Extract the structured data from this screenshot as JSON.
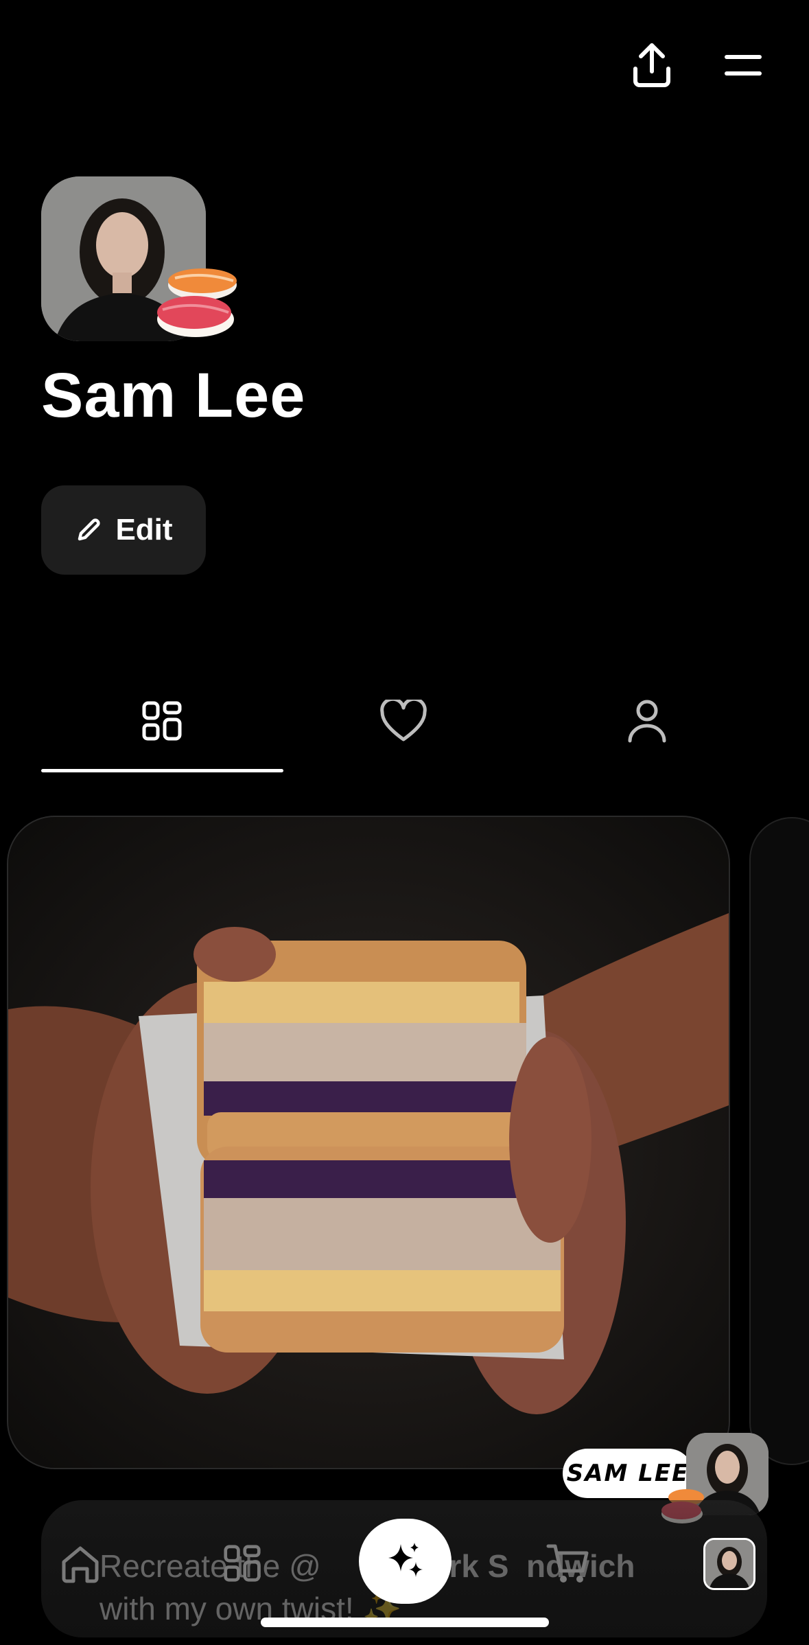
{
  "profile": {
    "name": "Sam Lee",
    "edit_label": "Edit"
  },
  "tabs": [
    {
      "icon": "grid-icon",
      "active": true
    },
    {
      "icon": "heart-icon",
      "active": false
    },
    {
      "icon": "user-icon",
      "active": false
    }
  ],
  "badge": {
    "label": "SAM LEE"
  },
  "post": {
    "caption_line1_a": "Recreate the @",
    "caption_line1_b": "y Pork S",
    "caption_line1_c": "ndwich",
    "caption_line2": "with my own twist! ✨"
  },
  "nav": {
    "items": [
      "home-icon",
      "grid-icon",
      "sparkle-icon",
      "cart-icon",
      "avatar"
    ]
  },
  "colors": {
    "background": "#000000",
    "surface": "#1e1e1e",
    "text": "#ffffff"
  }
}
